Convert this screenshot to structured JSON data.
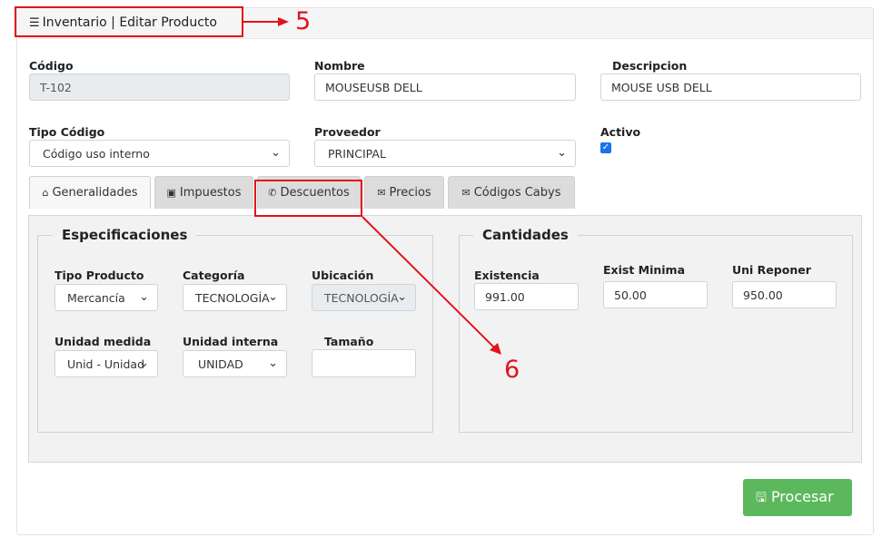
{
  "header": {
    "title": "Inventario | Editar Producto",
    "icon": "list-icon"
  },
  "fields": {
    "codigo": {
      "label": "Código",
      "value": "T-102"
    },
    "nombre": {
      "label": "Nombre",
      "value": "MOUSEUSB DELL"
    },
    "descripcion": {
      "label": "Descripcion",
      "value": "MOUSE USB DELL"
    },
    "tipo_codigo": {
      "label": "Tipo Código",
      "value": "Código uso interno"
    },
    "proveedor": {
      "label": "Proveedor",
      "value": "PRINCIPAL"
    },
    "activo": {
      "label": "Activo",
      "checked": true
    }
  },
  "tabs": [
    {
      "label": "Generalidades",
      "icon": "home-icon"
    },
    {
      "label": "Impuestos",
      "icon": "contact-icon"
    },
    {
      "label": "Descuentos",
      "icon": "phone-icon"
    },
    {
      "label": "Precios",
      "icon": "envelope-icon"
    },
    {
      "label": "Códigos Cabys",
      "icon": "envelope-icon"
    }
  ],
  "especificaciones": {
    "legend": "Especificaciones",
    "tipo_producto": {
      "label": "Tipo Producto",
      "value": "Mercancía"
    },
    "categoria": {
      "label": "Categoría",
      "value": "TECNOLOGÍA"
    },
    "ubicacion": {
      "label": "Ubicación",
      "value": "TECNOLOGÍA"
    },
    "unidad_medida": {
      "label": "Unidad medida",
      "value": "Unid - Unidad"
    },
    "unidad_interna": {
      "label": "Unidad interna",
      "value": "UNIDAD"
    },
    "tamano": {
      "label": "Tamaño",
      "value": ""
    }
  },
  "cantidades": {
    "legend": "Cantidades",
    "existencia": {
      "label": "Existencia",
      "value": "991.00"
    },
    "exist_minima": {
      "label": "Exist Minima",
      "value": "50.00"
    },
    "uni_reponer": {
      "label": "Uni Reponer",
      "value": "950.00"
    }
  },
  "actions": {
    "procesar": "Procesar"
  },
  "annotations": {
    "five": "5",
    "six": "6",
    "color": "#e0141a"
  },
  "colors": {
    "button": "#5cb85c",
    "checkbox": "#1a73e8"
  }
}
